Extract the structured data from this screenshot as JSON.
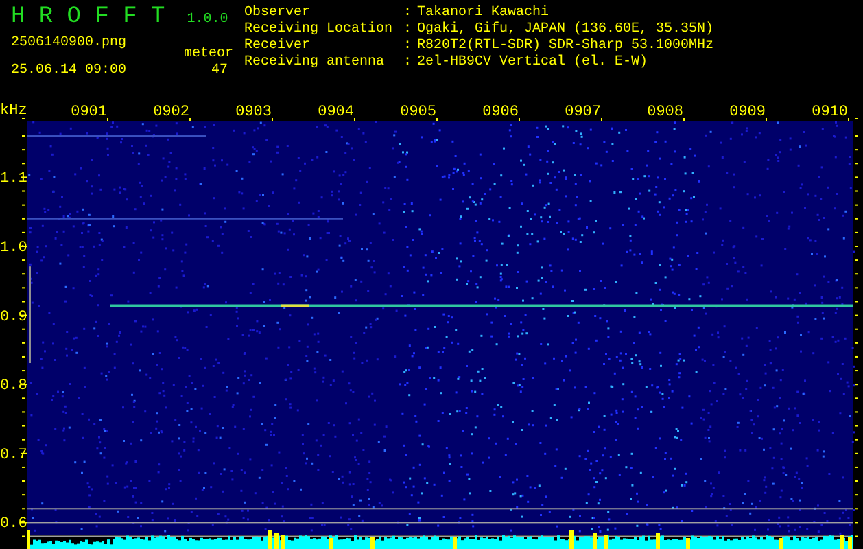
{
  "app": {
    "title": "H R O F F T",
    "version": "1.0.0",
    "file_name": "2506140900.png",
    "timestamp": "25.06.14 09:00",
    "count_label": "meteor",
    "count": "47"
  },
  "info": [
    {
      "label": "Observer",
      "separator": ":",
      "value": "Takanori Kawachi"
    },
    {
      "label": "Receiving Location",
      "separator": ":",
      "value": "Ogaki, Gifu, JAPAN (136.60E, 35.35N)"
    },
    {
      "label": "Receiver",
      "separator": ":",
      "value": "R820T2(RTL-SDR) SDR-Sharp 53.1000MHz"
    },
    {
      "label": "Receiving antenna",
      "separator": ":",
      "value": "2el-HB9CV Vertical (el. E-W)"
    }
  ],
  "spectrogram": {
    "y_unit": "kHz",
    "x_labels": [
      "0901",
      "0902",
      "0903",
      "0904",
      "0905",
      "0906",
      "0907",
      "0908",
      "0909",
      "0910"
    ],
    "y_labels": [
      "1.1",
      "1.0",
      "0.9",
      "0.8",
      "0.7",
      "0.6"
    ]
  }
}
